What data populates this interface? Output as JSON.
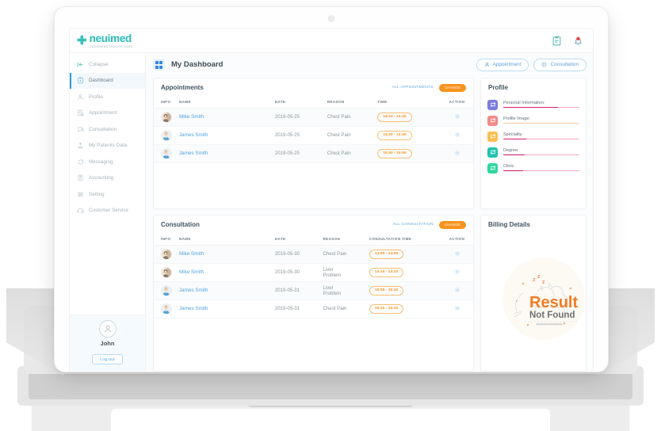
{
  "brand": {
    "name": "neuimed",
    "tagline": "ONDEMAND HEALTH CARE",
    "plus_icon": "plus-icon"
  },
  "topbar": {
    "icons": [
      {
        "name": "clipboard-icon",
        "label": "Reports"
      },
      {
        "name": "notification-bell-icon",
        "label": "Notifications"
      }
    ]
  },
  "sidebar": {
    "items": [
      {
        "label": "Collapse",
        "icon": "collapse-icon",
        "active": false
      },
      {
        "label": "Dashboard",
        "icon": "dashboard-icon",
        "active": true
      },
      {
        "label": "Profile",
        "icon": "profile-icon",
        "active": false
      },
      {
        "label": "Appointment",
        "icon": "appointment-icon",
        "active": false
      },
      {
        "label": "Consultation",
        "icon": "consultation-icon",
        "active": false
      },
      {
        "label": "My Patients Data",
        "icon": "patients-data-icon",
        "active": false
      },
      {
        "label": "Messaging",
        "icon": "messaging-icon",
        "active": false
      },
      {
        "label": "Accounting",
        "icon": "accounting-icon",
        "active": false
      },
      {
        "label": "Setting",
        "icon": "setting-icon",
        "active": false
      },
      {
        "label": "Customer Service",
        "icon": "customer-service-icon",
        "active": false
      }
    ],
    "user": {
      "name": "John",
      "logout_label": "Log out",
      "avatar_icon": "user-avatar-icon"
    }
  },
  "page": {
    "title": "My Dashboard",
    "grid_icon": "grid-icon",
    "actions": [
      {
        "label": "Appointment",
        "icon": "user-icon"
      },
      {
        "label": "Consultation",
        "icon": "chat-icon"
      }
    ]
  },
  "appointments": {
    "title": "Appointments",
    "link_label": "ALL APPOINTMENTS",
    "badge_label": "CHANGE",
    "columns": [
      "INFO",
      "NAME",
      "DATE",
      "REASON",
      "TIME",
      "ACTION"
    ],
    "rows": [
      {
        "name": "Mike Smith",
        "date": "2019-05-25",
        "reason": "Chest Pain",
        "time": "14:10 - 14:20",
        "avatar": "patient-avatar-1",
        "action_icon": "gear-icon"
      },
      {
        "name": "James Smith",
        "date": "2019-05-25",
        "reason": "Chest Pain",
        "time": "14:30 - 14:40",
        "avatar": "patient-avatar-2",
        "action_icon": "gear-icon"
      },
      {
        "name": "James Smith",
        "date": "2019-05-25",
        "reason": "Chest Pain",
        "time": "15:40 - 15:50",
        "avatar": "patient-avatar-2",
        "action_icon": "gear-icon"
      }
    ]
  },
  "consultation": {
    "title": "Consultation",
    "link_label": "ALL CONSULTATION",
    "badge_label": "CHANGE",
    "columns": [
      "INFO",
      "NAME",
      "DATE",
      "REASON",
      "CONSULTATION TIME",
      "ACTION"
    ],
    "rows": [
      {
        "name": "Mike Smith",
        "date": "2019-05-30",
        "reason": "Chest Pain",
        "time": "14:00 - 14:05",
        "avatar": "patient-avatar-1",
        "action_icon": "gear-icon"
      },
      {
        "name": "Mike Smith",
        "date": "2019-05-30",
        "reason": "Liver Problem",
        "time": "14:15 - 14:20",
        "avatar": "patient-avatar-1",
        "action_icon": "gear-icon"
      },
      {
        "name": "James Smith",
        "date": "2019-05-31",
        "reason": "Liver Problem",
        "time": "15:05 - 15:10",
        "avatar": "patient-avatar-2",
        "action_icon": "gear-icon"
      },
      {
        "name": "James Smith",
        "date": "2019-05-31",
        "reason": "Chest Pain",
        "time": "15:15 - 15:20",
        "avatar": "patient-avatar-2",
        "action_icon": "gear-icon"
      }
    ]
  },
  "profile": {
    "title": "Profile",
    "rows": [
      {
        "label": "Personal Information:",
        "icon": "refresh-icon",
        "icon_color": "#7b7ce0",
        "progress": 72,
        "bar_color": "#e31b6d",
        "track_color": "#f6a8c0"
      },
      {
        "label": "Profile Image:",
        "icon": "refresh-icon",
        "icon_color": "#f28a86",
        "progress": 0,
        "bar_color": "#e31b6d",
        "track_color": "#fbc9a8"
      },
      {
        "label": "Speciality:",
        "icon": "refresh-icon",
        "icon_color": "#fbbe4e",
        "progress": 30,
        "bar_color": "#e31b6d",
        "track_color": "#f6a8c0"
      },
      {
        "label": "Degree:",
        "icon": "refresh-icon",
        "icon_color": "#22c4ad",
        "progress": 28,
        "bar_color": "#c2186a",
        "track_color": "#f6a8c0"
      },
      {
        "label": "Clinic:",
        "icon": "refresh-icon",
        "icon_color": "#2fd6a0",
        "progress": 26,
        "bar_color": "#c2186a",
        "track_color": "#f6a8c0"
      }
    ]
  },
  "billing": {
    "title": "Billing Details",
    "empty_primary": "Result",
    "empty_secondary": "Not Found",
    "empty_illustration": "sleeping-cat-icon"
  },
  "colors": {
    "brand_teal": "#29bdb6",
    "accent_blue": "#4ea3e4",
    "accent_orange": "#f7931e",
    "active_nav": "#2f9ae0"
  }
}
